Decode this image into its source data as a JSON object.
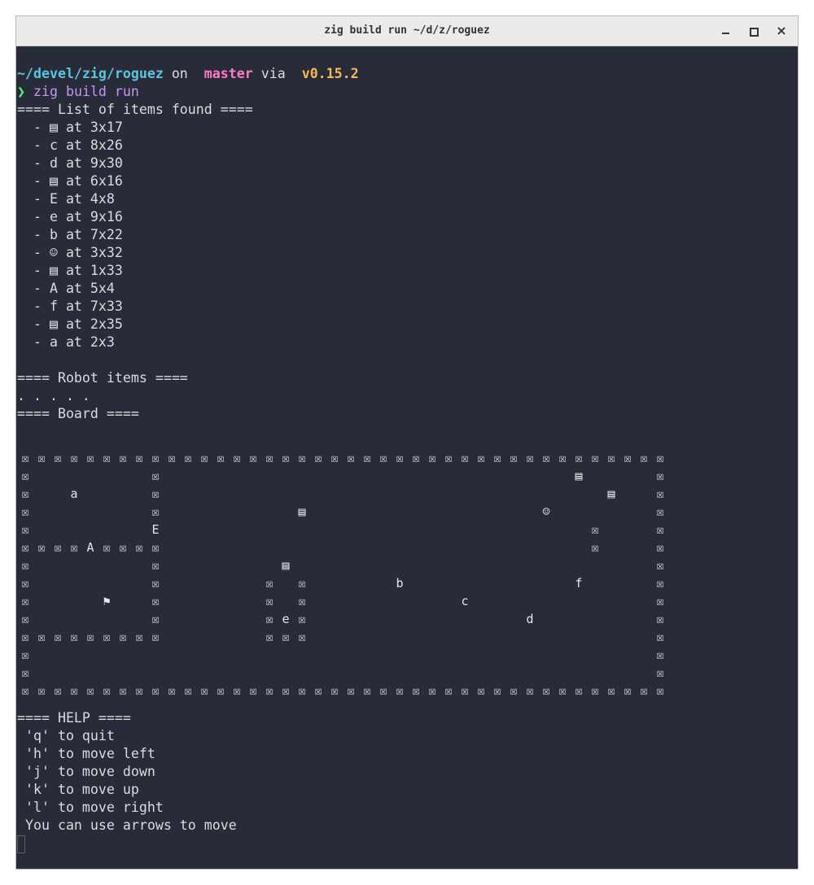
{
  "window": {
    "title": "zig build run ~/d/z/roguez",
    "close_label": "×"
  },
  "prompt": {
    "path": "~/devel/zig/roguez",
    "on": " on ",
    "branch_icon": "",
    "branch": "master",
    "via": " via ",
    "zig_icon": "",
    "zig_version": "v0.15.2",
    "symbol": "❯",
    "command": "zig build run"
  },
  "items": {
    "header": "==== List of items found ====",
    "lines": [
      "  - ▤ at 3x17",
      "  - c at 8x26",
      "  - d at 9x30",
      "  - ▤ at 6x16",
      "  - E at 4x8",
      "  - e at 9x16",
      "  - b at 7x22",
      "  - ☺ at 3x32",
      "  - ▤ at 1x33",
      "  - A at 5x4",
      "  - f at 7x33",
      "  - ▤ at 2x35",
      "  - a at 2x3"
    ]
  },
  "robot": {
    "header": "==== Robot items ====",
    "line": ". . . . ."
  },
  "board": {
    "header": "==== Board ====",
    "wall_glyph": "☒",
    "rows": [
      "########################################",
      "#       #                         ▤    #",
      "#  a    #                           ▤  #",
      "#       #        ▤              ☺      #",
      "#       E                          #   #",
      "####A####                          #   #",
      "#       #       ▤                      #",
      "#       #      # #     b          f    #",
      "#    ⚑  #      # #         c           #",
      "#       #      #e#             d       #",
      "#########      ###                     #",
      "#                                      #",
      "#                                      #",
      "########################################"
    ]
  },
  "help": {
    "header": "==== HELP ====",
    "lines": [
      " 'q' to quit",
      " 'h' to move left",
      " 'j' to move down",
      " 'k' to move up",
      " 'l' to move right",
      " You can use arrows to move"
    ]
  }
}
